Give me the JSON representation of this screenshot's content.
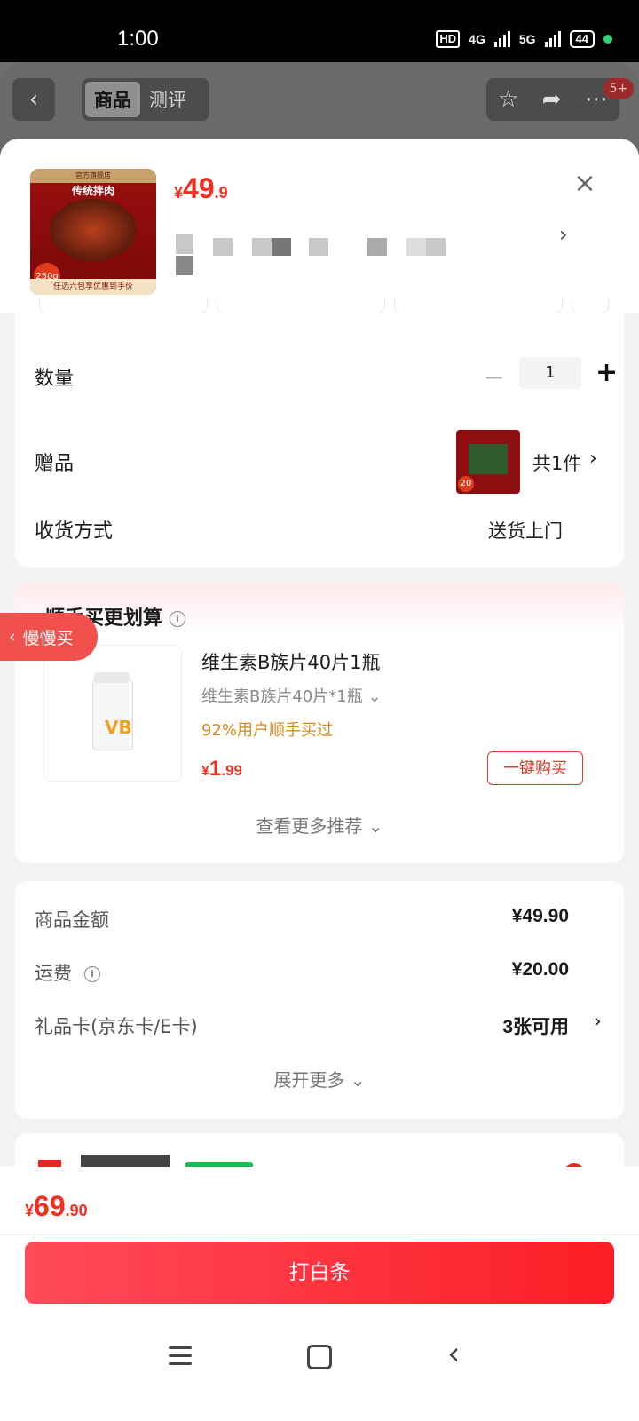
{
  "status_bar": {
    "time": "1:00",
    "network_hd": "HD",
    "network_1": "4G",
    "network_2": "5G",
    "battery": "44"
  },
  "header": {
    "tabs": [
      {
        "label": "商品",
        "active": true
      },
      {
        "label": "测评",
        "active": false
      }
    ],
    "notification_badge": "5+"
  },
  "product": {
    "image_title": "传统拌肉",
    "image_top_bar": "官方旗舰店",
    "image_weight": "250g",
    "image_footer": "任选六包享优惠到手价",
    "price_currency": "¥",
    "price_int": "49",
    "price_dec": ".9"
  },
  "quantity": {
    "label": "数量",
    "value": "1",
    "minus": "−",
    "plus": "+"
  },
  "gift": {
    "label": "赠品",
    "count": "共1件"
  },
  "delivery": {
    "label": "收货方式",
    "value": "送货上门"
  },
  "slow_buy": {
    "label": "慢慢买"
  },
  "recommend": {
    "title": "顺手买更划算",
    "item_name": "维生素B族片40片1瓶",
    "item_spec": "维生素B族片40片*1瓶",
    "item_stat": "92%用户顺手买过",
    "price_currency": "¥",
    "price_int": "1",
    "price_dec": ".99",
    "buy_label": "一键购买",
    "more_label": "查看更多推荐",
    "image_label": "VB"
  },
  "fees": {
    "items": [
      {
        "label": "商品金额",
        "value": "¥49.90"
      },
      {
        "label": "运费",
        "value": "¥20.00"
      },
      {
        "label": "礼品卡(京东卡/E卡)",
        "value": "3张可用"
      }
    ],
    "expand_label": "展开更多"
  },
  "bottom": {
    "total_currency": "¥",
    "total_int": "69",
    "total_dec": ".90",
    "pay_label": "打白条"
  },
  "colors": {
    "accent": "#f0301f",
    "pay_gradient_start": "#ff4a5b",
    "pay_gradient_end": "#fc1e24",
    "stat_orange": "#d98a1a"
  }
}
